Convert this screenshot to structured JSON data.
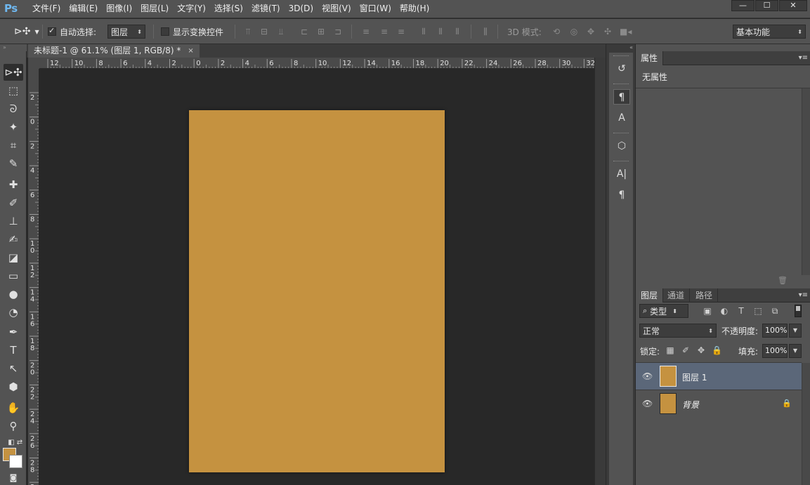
{
  "app": {
    "logo": "Ps"
  },
  "menu": {
    "items": [
      "文件(F)",
      "编辑(E)",
      "图像(I)",
      "图层(L)",
      "文字(Y)",
      "选择(S)",
      "滤镜(T)",
      "3D(D)",
      "视图(V)",
      "窗口(W)",
      "帮助(H)"
    ]
  },
  "window_controls": {
    "minimize": "—",
    "maximize": "☐",
    "close": "✕"
  },
  "options_bar": {
    "auto_select_label": "自动选择:",
    "auto_select_checked": true,
    "auto_select_target": "图层",
    "show_transform_label": "显示变换控件",
    "show_transform_checked": false,
    "mode_3d_label": "3D 模式:",
    "workspace": "基本功能"
  },
  "document": {
    "tab_title": "未标题-1 @ 61.1% (图层 1, RGB/8) *",
    "close_symbol": "×",
    "canvas_color": "#c59240",
    "ruler_h_labels": [
      "12",
      "10",
      "8",
      "6",
      "4",
      "2",
      "0",
      "2",
      "4",
      "6",
      "8",
      "10",
      "12",
      "14",
      "16",
      "18",
      "20",
      "22",
      "24",
      "26",
      "28",
      "30",
      "32"
    ],
    "ruler_v_labels": [
      "2",
      "0",
      "2",
      "4",
      "6",
      "8",
      "1 0",
      "1 2",
      "1 4",
      "1 6",
      "1 8",
      "2 0",
      "2 2",
      "2 4",
      "2 6",
      "2 8",
      "3"
    ]
  },
  "colors": {
    "foreground": "#c59240",
    "background": "#ffffff",
    "accent_selected_layer": "#5b6779"
  },
  "properties_panel": {
    "tab": "属性",
    "content": "无属性"
  },
  "layers_panel": {
    "tabs": [
      "图层",
      "通道",
      "路径"
    ],
    "filter_kind": "类型",
    "blend_mode": "正常",
    "opacity_label": "不透明度:",
    "opacity_value": "100%",
    "lock_label": "锁定:",
    "fill_label": "填充:",
    "fill_value": "100%",
    "layers": [
      {
        "name": "图层 1",
        "selected": true,
        "locked": false
      },
      {
        "name": "背景",
        "selected": false,
        "locked": true
      }
    ]
  }
}
